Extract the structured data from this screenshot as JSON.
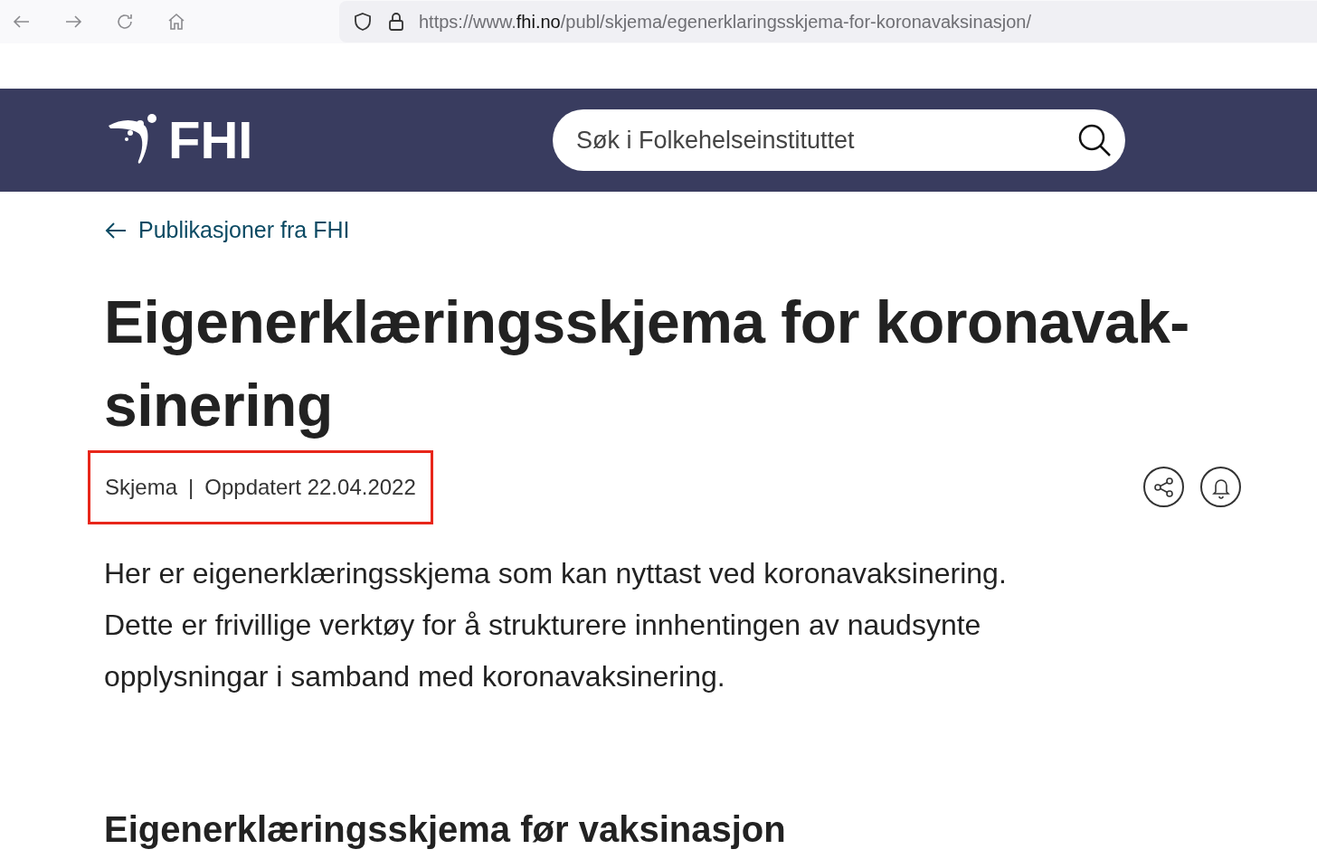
{
  "browser": {
    "url_prefix": "https://www.",
    "url_domain": "fhi.no",
    "url_path": "/publ/skjema/egenerklaringsskjema-for-koronavaksinasjon/"
  },
  "header": {
    "logo_text": "FHI",
    "search": {
      "placeholder": "Søk i Folkehelseinstituttet"
    }
  },
  "back_link": "Publikasjoner fra FHI",
  "title_lines": [
    "Eigenerklæringsskjema for koronavak-",
    "sinering"
  ],
  "meta": {
    "type": "Skjema",
    "separator": "|",
    "updated": "Oppdatert 22.04.2022",
    "highlighted": true
  },
  "intro": "Her er eigenerklæringsskjema som kan nyttast ved koronavaksinering. Dette er frivillige verktøy for å strukturere innhentingen av naudsynte opplysningar i samband med koronavaksinering.",
  "section_heading": "Eigenerklæringsskjema før vaksinasjon"
}
